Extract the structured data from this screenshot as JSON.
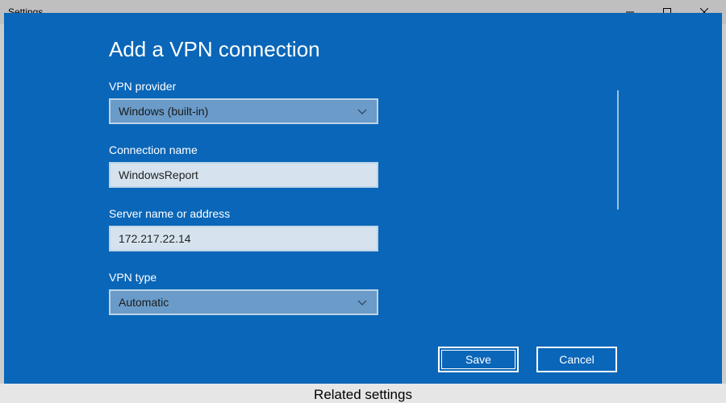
{
  "parent": {
    "title": "Settings",
    "footer_heading": "Related settings"
  },
  "modal": {
    "title": "Add a VPN connection",
    "fields": {
      "provider": {
        "label": "VPN provider",
        "value": "Windows (built-in)"
      },
      "connection_name": {
        "label": "Connection name",
        "value": "WindowsReport"
      },
      "server": {
        "label": "Server name or address",
        "value": "172.217.22.14"
      },
      "vpn_type": {
        "label": "VPN type",
        "value": "Automatic"
      }
    },
    "buttons": {
      "save": "Save",
      "cancel": "Cancel"
    }
  }
}
